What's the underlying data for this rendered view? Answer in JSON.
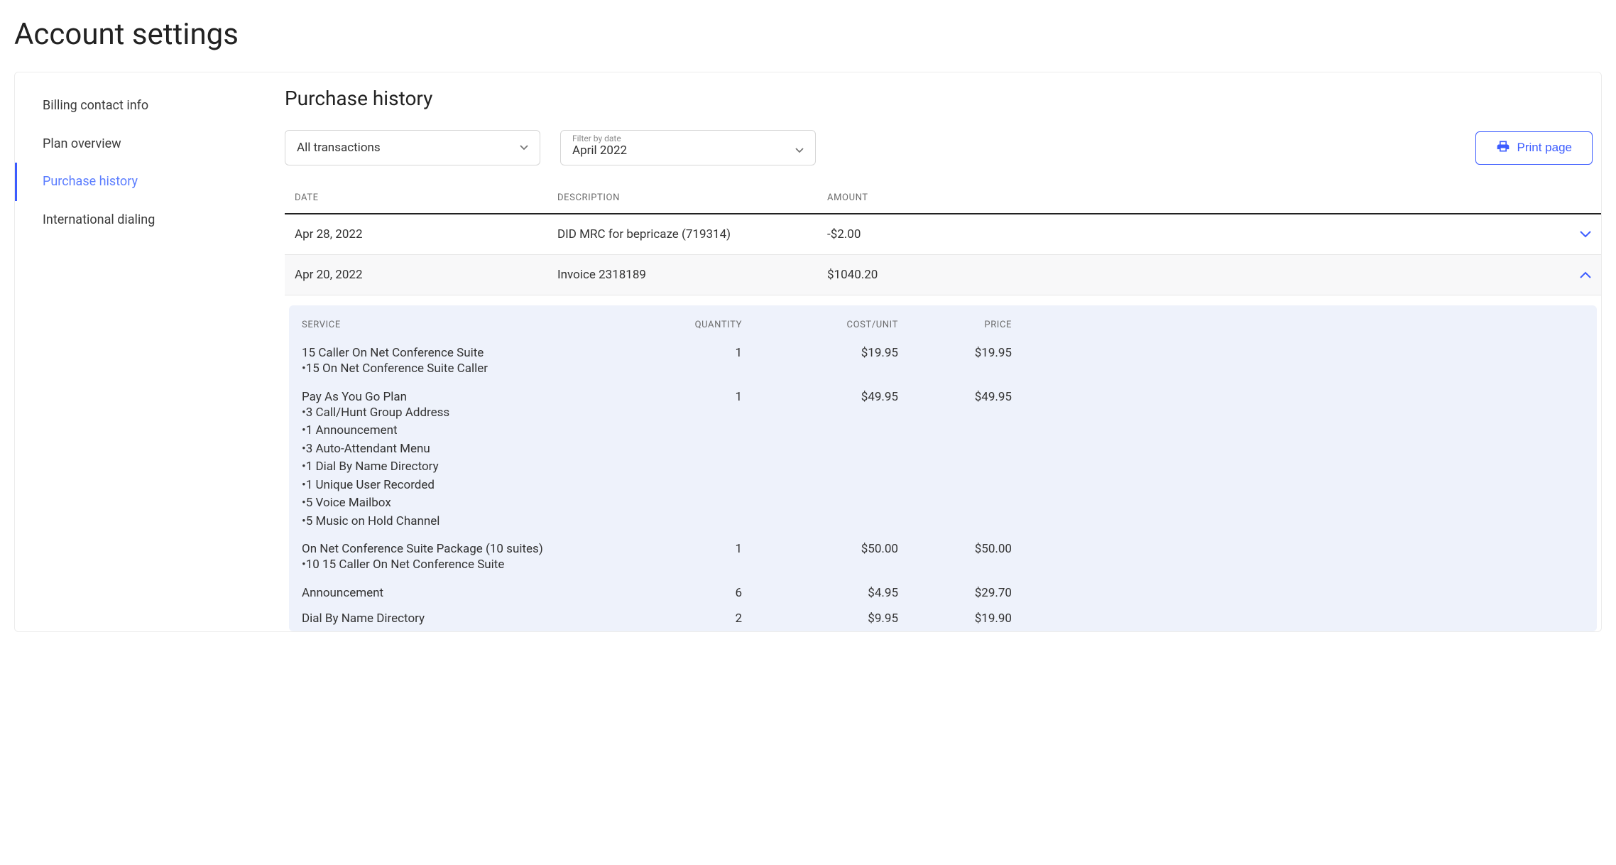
{
  "page_title": "Account settings",
  "sidebar": {
    "items": [
      {
        "label": "Billing contact info",
        "active": false
      },
      {
        "label": "Plan overview",
        "active": false
      },
      {
        "label": "Purchase history",
        "active": true
      },
      {
        "label": "International dialing",
        "active": false
      }
    ]
  },
  "main": {
    "section_title": "Purchase history",
    "filter_transactions": {
      "value": "All transactions"
    },
    "filter_date": {
      "label": "Filter by date",
      "value": "April 2022"
    },
    "print_label": "Print page"
  },
  "tx_table": {
    "headers": {
      "date": "DATE",
      "description": "DESCRIPTION",
      "amount": "AMOUNT"
    },
    "rows": [
      {
        "date": "Apr 28, 2022",
        "description": "DID MRC for bepricaze (719314)",
        "amount": "-$2.00",
        "expanded": false
      },
      {
        "date": "Apr 20, 2022",
        "description": "Invoice 2318189",
        "amount": "$1040.20",
        "expanded": true
      }
    ]
  },
  "detail": {
    "headers": {
      "service": "SERVICE",
      "quantity": "QUANTITY",
      "cost_unit": "COST/UNIT",
      "price": "PRICE"
    },
    "rows": [
      {
        "service": "15 Caller On Net Conference Suite",
        "sub": [
          "15 On Net Conference Suite Caller"
        ],
        "quantity": "1",
        "cost_unit": "$19.95",
        "price": "$19.95"
      },
      {
        "service": "Pay As You Go Plan",
        "sub": [
          "3 Call/Hunt Group Address",
          "1 Announcement",
          "3 Auto-Attendant Menu",
          "1 Dial By Name Directory",
          "1 Unique User Recorded",
          "5 Voice Mailbox",
          "5 Music on Hold Channel"
        ],
        "quantity": "1",
        "cost_unit": "$49.95",
        "price": "$49.95"
      },
      {
        "service": "On Net Conference Suite Package (10 suites)",
        "sub": [
          "10 15 Caller On Net Conference Suite"
        ],
        "quantity": "1",
        "cost_unit": "$50.00",
        "price": "$50.00"
      },
      {
        "service": "Announcement",
        "sub": [],
        "quantity": "6",
        "cost_unit": "$4.95",
        "price": "$29.70"
      },
      {
        "service": "Dial By Name Directory",
        "sub": [],
        "quantity": "2",
        "cost_unit": "$9.95",
        "price": "$19.90"
      }
    ]
  }
}
